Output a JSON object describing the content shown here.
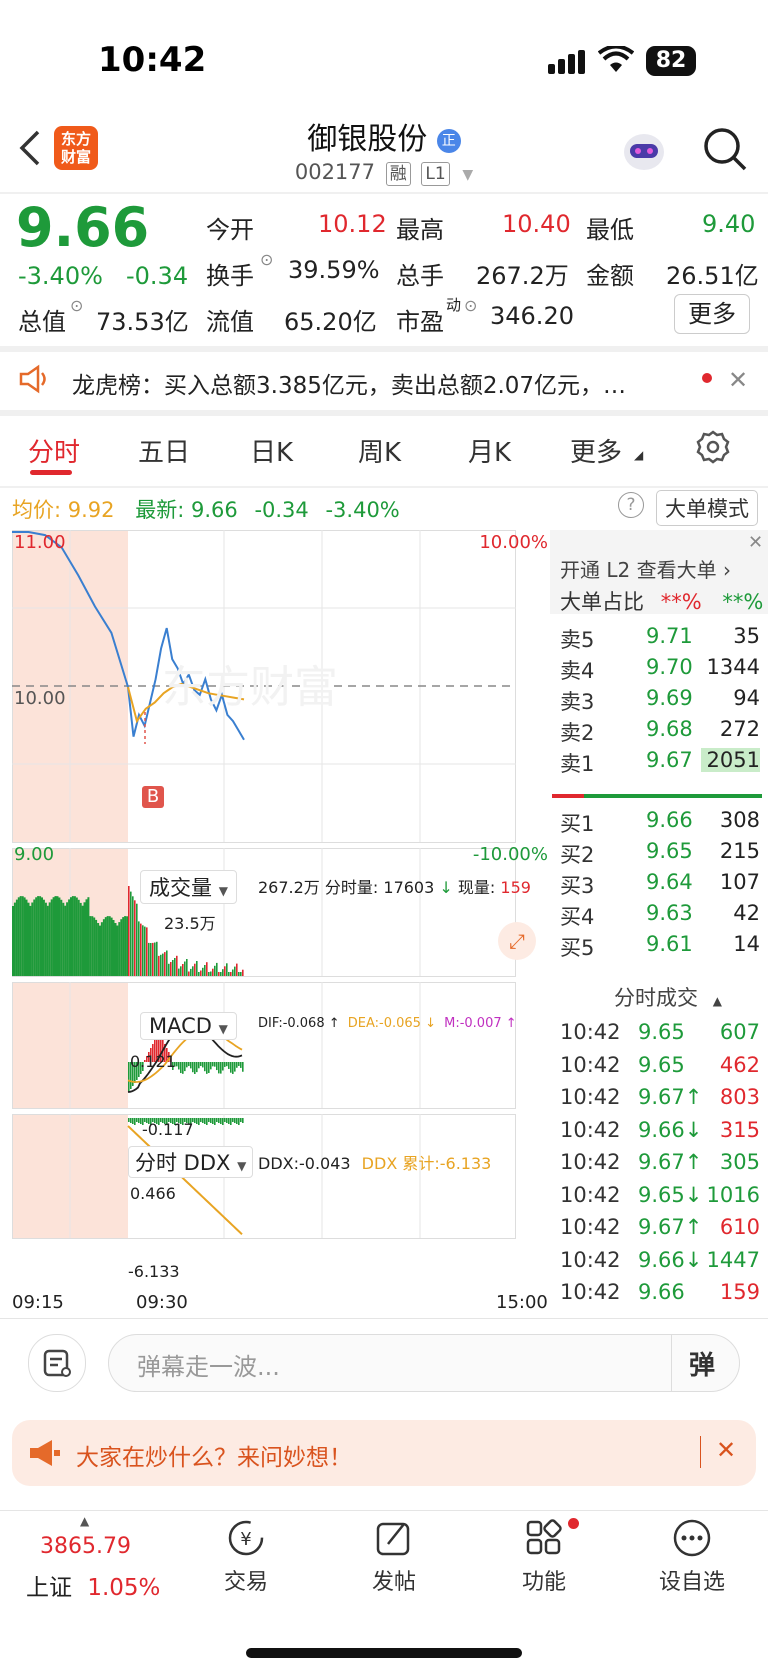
{
  "status": {
    "time": "10:42",
    "battery": "82"
  },
  "header": {
    "logo_text": "东方财富",
    "title": "御银股份",
    "title_badge": "正",
    "code": "002177",
    "tags": [
      "融",
      "L1"
    ]
  },
  "quote": {
    "price": "9.66",
    "change_pct": "-3.40%",
    "change": "-0.34",
    "open_label": "今开",
    "open": "10.12",
    "high_label": "最高",
    "high": "10.40",
    "low_label": "最低",
    "low": "9.40",
    "turnover_label": "换手",
    "turnover": "39.59%",
    "volume_label": "总手",
    "volume": "267.2万",
    "amount_label": "金额",
    "amount": "26.51亿",
    "mktcap_label": "总值",
    "mktcap": "73.53亿",
    "float_label": "流值",
    "float": "65.20亿",
    "pe_label": "市盈",
    "pe_sup": "动",
    "pe": "346.20",
    "more_label": "更多"
  },
  "notice": {
    "text": "龙虎榜：买入总额3.385亿元，卖出总额2.07亿元，…"
  },
  "tabs": [
    "分时",
    "五日",
    "日K",
    "周K",
    "月K",
    "更多"
  ],
  "summary": {
    "avg_label": "均价:",
    "avg": "9.92",
    "latest_label": "最新:",
    "latest": "9.66",
    "change": "-0.34",
    "change_pct": "-3.40%",
    "mode_button": "大单模式"
  },
  "chart_data": {
    "type": "line",
    "price_axis": {
      "max": "11.00",
      "mid": "10.00",
      "min": "9.00",
      "max_pct": "10.00%",
      "min_pct": "-10.00%"
    },
    "time_labels": [
      "09:15",
      "09:30",
      "15:00"
    ],
    "buy_marker": "B",
    "volume_panel": {
      "selector": "成交量",
      "total": "267.2万",
      "tick_label": "分时量: 17603",
      "now_label": "现量:",
      "now": "159",
      "peak_label": "23.5万"
    },
    "macd_panel": {
      "selector": "MACD",
      "dif": "DIF:-0.068 ↑",
      "dea": "DEA:-0.065 ↓",
      "m": "M:-0.007 ↑",
      "top_label": "0.121",
      "bottom_label": "-0.117"
    },
    "ddx_panel": {
      "selector": "分时 DDX",
      "ddx": "DDX:-0.043",
      "ddx_cum": "DDX 累计:-6.133",
      "top_label": "0.466",
      "bottom_label": "-6.133"
    },
    "price_series": [
      11.0,
      11.0,
      10.98,
      10.9,
      10.72,
      10.52,
      10.35,
      10.0,
      9.68,
      9.82,
      9.75,
      9.9,
      10.05,
      10.25,
      10.38,
      10.18,
      10.12,
      10.02,
      10.08,
      9.98,
      9.95,
      10.05,
      9.92,
      9.85,
      9.95,
      9.82,
      9.78,
      9.72,
      9.66
    ],
    "avg_series": [
      10.0,
      9.78,
      9.86,
      9.9,
      9.96,
      10.0,
      10.02,
      10.0,
      9.98,
      9.96,
      9.95,
      9.94,
      9.93,
      9.92
    ]
  },
  "orderbook": {
    "banner": "开通 L2 查看大单 ›",
    "ratio_label": "大单占比",
    "ratio_buy": "**%",
    "ratio_sell": "**%",
    "asks": [
      {
        "label": "卖5",
        "price": "9.71",
        "vol": "35"
      },
      {
        "label": "卖4",
        "price": "9.70",
        "vol": "1344"
      },
      {
        "label": "卖3",
        "price": "9.69",
        "vol": "94"
      },
      {
        "label": "卖2",
        "price": "9.68",
        "vol": "272"
      },
      {
        "label": "卖1",
        "price": "9.67",
        "vol": "2051"
      }
    ],
    "bids": [
      {
        "label": "买1",
        "price": "9.66",
        "vol": "308"
      },
      {
        "label": "买2",
        "price": "9.65",
        "vol": "215"
      },
      {
        "label": "买3",
        "price": "9.64",
        "vol": "107"
      },
      {
        "label": "买4",
        "price": "9.63",
        "vol": "42"
      },
      {
        "label": "买5",
        "price": "9.61",
        "vol": "14"
      }
    ],
    "ticks_title": "分时成交",
    "ticks": [
      {
        "time": "10:42",
        "price": "9.65",
        "vol": "607"
      },
      {
        "time": "10:42",
        "price": "9.65",
        "vol": "462"
      },
      {
        "time": "10:42",
        "price": "9.67↑",
        "vol": "803"
      },
      {
        "time": "10:42",
        "price": "9.66↓",
        "vol": "315"
      },
      {
        "time": "10:42",
        "price": "9.67↑",
        "vol": "305"
      },
      {
        "time": "10:42",
        "price": "9.65↓",
        "vol": "1016"
      },
      {
        "time": "10:42",
        "price": "9.67↑",
        "vol": "610"
      },
      {
        "time": "10:42",
        "price": "9.66↓",
        "vol": "1447"
      },
      {
        "time": "10:42",
        "price": "9.66",
        "vol": "159"
      }
    ]
  },
  "comment": {
    "placeholder": "弹幕走一波...",
    "danmu_label": "弹"
  },
  "ai_bar": {
    "text": "大家在炒什么？来问妙想！"
  },
  "bottom_nav": {
    "index_value": "3865.79",
    "index_name": "上证",
    "index_change": "1.05%",
    "items": [
      "交易",
      "发帖",
      "功能",
      "设自选"
    ]
  },
  "colors": {
    "up": "#e0282e",
    "down": "#1e9a3a",
    "avg": "#e8a423",
    "price_line": "#3a7fd0",
    "pre_market_bg": "#fce3d9"
  }
}
